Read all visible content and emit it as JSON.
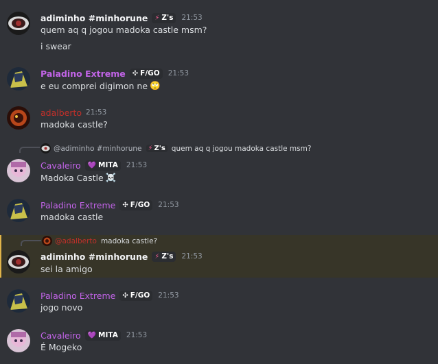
{
  "colors": {
    "background": "#313338",
    "highlight_bg": "#373528",
    "highlight_bar": "#e0b44a",
    "name_white": "#f2f3f5",
    "name_purple": "#c264e8",
    "name_red": "#c0302a",
    "time": "#949ba4"
  },
  "messages": [
    {
      "user": "adiminho #minhorune",
      "tag_icon": "⚡",
      "tag": "Z's",
      "time": "21:53",
      "lines": [
        "quem aq q jogou madoka castle msm?",
        "i swear"
      ]
    },
    {
      "user": "Paladino Extreme",
      "tag_icon": "✣",
      "tag": "F/GO",
      "time": "21:53",
      "lines": [
        "e eu comprei digimon ne"
      ],
      "emoji": "🙄"
    },
    {
      "user": "adalberto",
      "time": "21:53",
      "lines": [
        "madoka castle?"
      ]
    },
    {
      "reply_name": "@adiminho #minhorune",
      "reply_tag_icon": "⚡",
      "reply_tag": "Z's",
      "reply_text": "quem aq q jogou madoka castle msm?",
      "user": "Cavaleiro",
      "tag_icon": "💜",
      "tag": "MITA",
      "time": "21:53",
      "lines": [
        "Madoka Castle"
      ],
      "emoji": "☠️"
    },
    {
      "user": "Paladino Extreme",
      "tag_icon": "✣",
      "tag": "F/GO",
      "time": "21:53",
      "lines": [
        "madoka castle"
      ]
    },
    {
      "reply_name": "@adalberto",
      "reply_text": "madoka castle?",
      "user": "adiminho #minhorune",
      "tag_icon": "⚡",
      "tag": "Z's",
      "time": "21:53",
      "lines": [
        "sei la amigo"
      ]
    },
    {
      "user": "Paladino Extreme",
      "tag_icon": "✣",
      "tag": "F/GO",
      "time": "21:53",
      "lines": [
        "jogo novo"
      ]
    },
    {
      "user": "Cavaleiro",
      "tag_icon": "💜",
      "tag": "MITA",
      "time": "21:53",
      "lines": [
        "É Mogeko"
      ]
    }
  ]
}
